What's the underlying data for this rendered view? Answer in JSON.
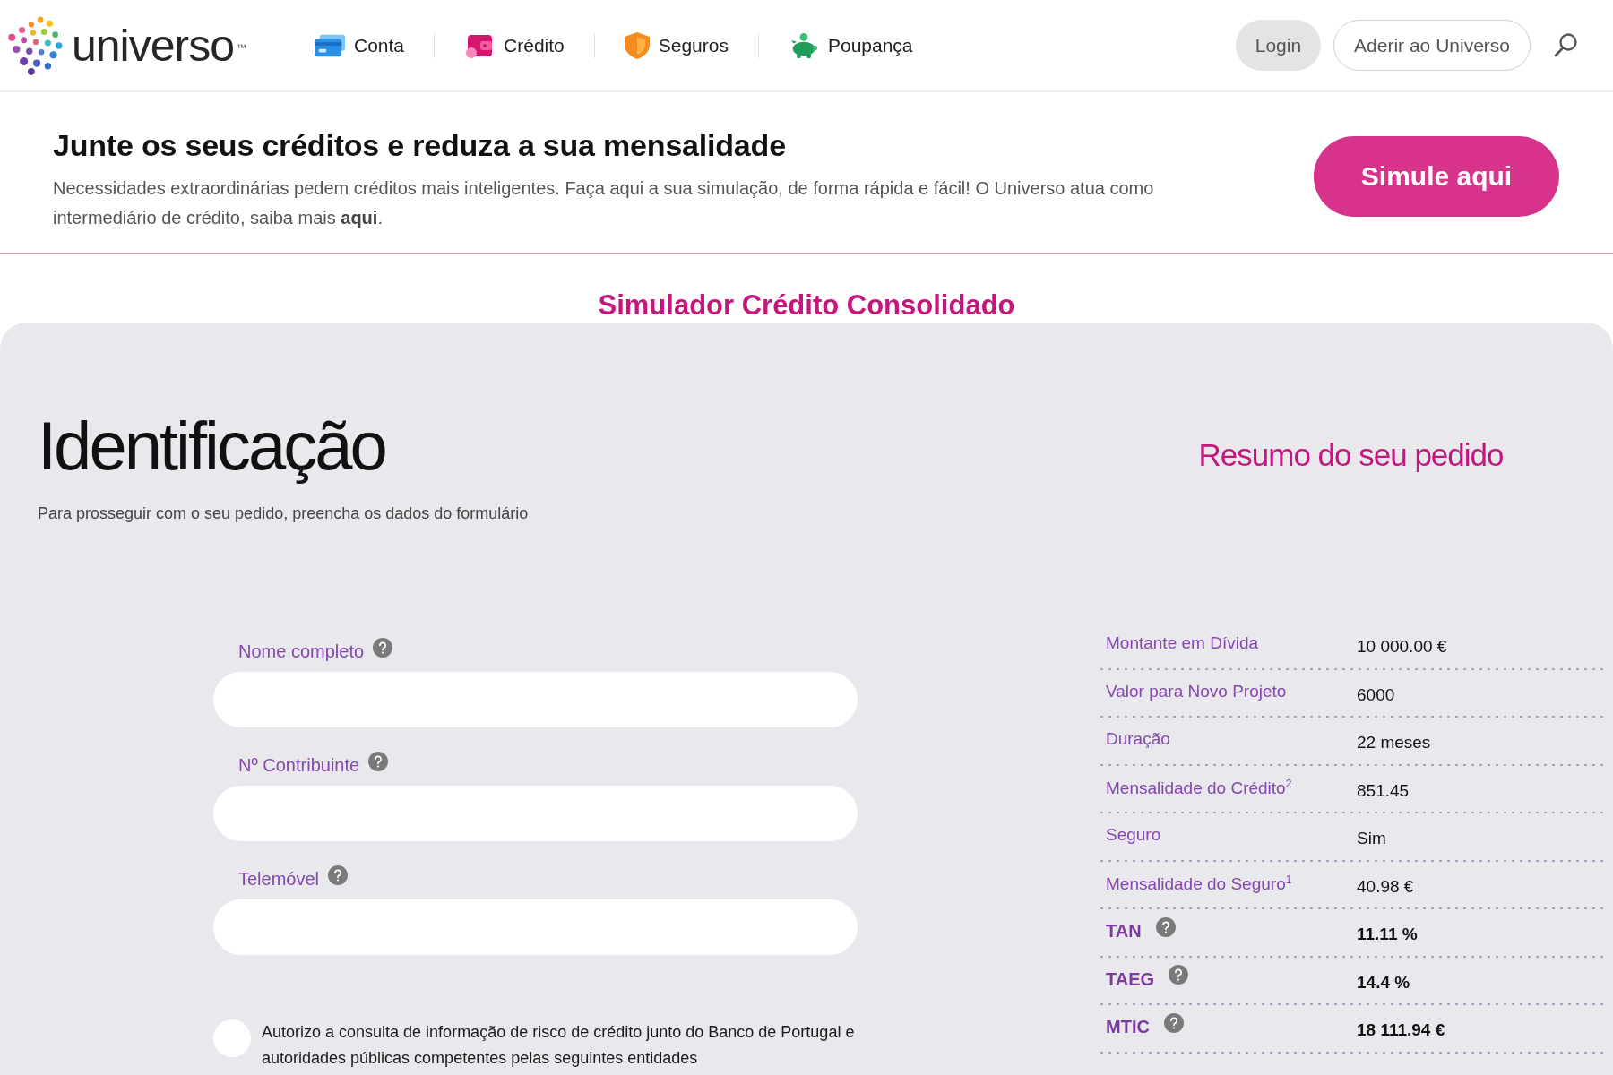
{
  "header": {
    "logo": {
      "wordmark": "universo",
      "trademark": "™"
    },
    "nav": [
      "Conta",
      "Crédito",
      "Seguros",
      "Poupança"
    ],
    "login": "Login",
    "join": "Aderir ao Universo"
  },
  "banner": {
    "title": "Junte os seus créditos e reduza a sua mensalidade",
    "text": "Necessidades extraordinárias pedem créditos mais inteligentes. Faça aqui a sua simulação, de forma rápida e fácil! O Universo atua como intermediário de crédito, saiba mais **aqui**.",
    "button": "Simule aqui"
  },
  "section_title": "Simulador Crédito Consolidado",
  "form": {
    "title": "Identificação",
    "subtitle": "Para prosseguir com o seu pedido, preencha os dados do formulário",
    "fields": [
      {
        "label": "Nome completo",
        "help": true
      },
      {
        "label": "Nº Contribuinte",
        "help": true
      },
      {
        "label": "Telemóvel",
        "help": true
      }
    ],
    "consent": {
      "checked": false,
      "text": "Autorizo a consulta de informação de risco de crédito junto do Banco de Portugal e autoridades públicas competentes pelas seguintes entidades"
    }
  },
  "summary": {
    "title": "Resumo do seu pedido",
    "rows": [
      {
        "label": "Montante em Dívida",
        "value": "10 000.00 €",
        "strong": false,
        "help": false
      },
      {
        "label": "Valor para Novo Projeto",
        "value": "6000",
        "strong": false,
        "help": false
      },
      {
        "label": "Duração",
        "value": "22 meses",
        "strong": false,
        "help": false
      },
      {
        "label": "Mensalidade do Crédito$^{2}$",
        "value": "851.45",
        "strong": false,
        "help": false
      },
      {
        "label": "Seguro",
        "value": "Sim",
        "strong": false,
        "help": false
      },
      {
        "label": "Mensalidade do Seguro$^{1}$",
        "value": "40.98 €",
        "strong": false,
        "help": false
      },
      {
        "label": "TAN",
        "value": "11.11 %",
        "strong": true,
        "help": true
      },
      {
        "label": "TAEG",
        "value": "14.4 %",
        "strong": true,
        "help": true
      },
      {
        "label": "MTIC",
        "value": "18 111.94 €",
        "strong": true,
        "help": true
      }
    ]
  }
}
